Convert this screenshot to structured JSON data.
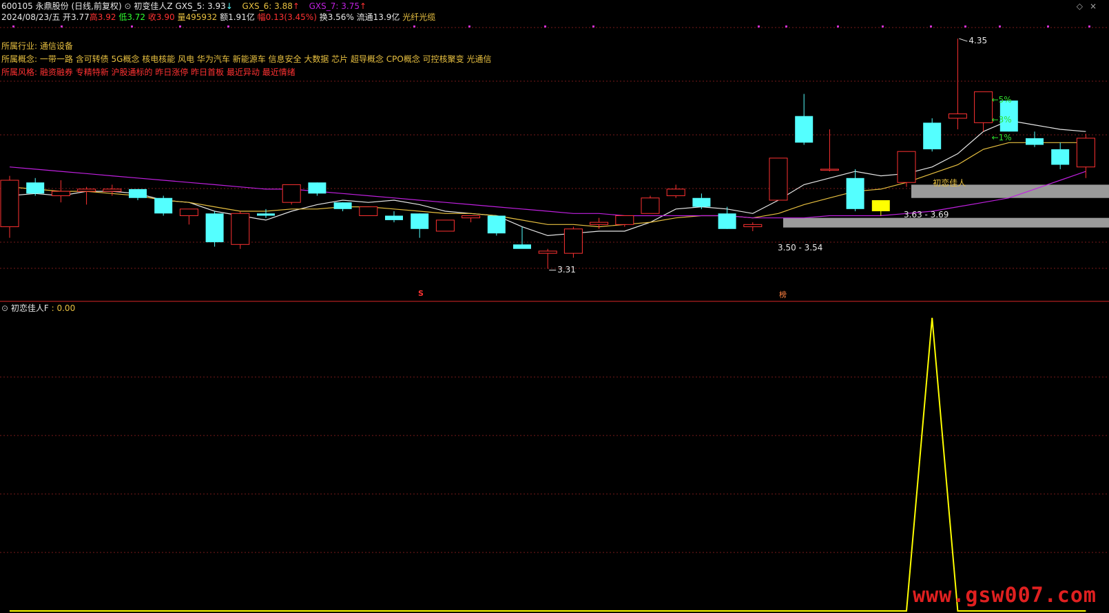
{
  "header": {
    "code": "600105",
    "name": "永鼎股份",
    "period": "(日线,前复权)",
    "indicator_name": "初变佳人Z",
    "gxs5": "GXS_5: 3.93",
    "gxs5_arrow": "↓",
    "gxs6": "GXS_6: 3.88",
    "gxs6_arrow": "↑",
    "gxs7": "GXS_7: 3.75",
    "gxs7_arrow": "↑",
    "collapse_glyph": "◇",
    "close_glyph": "×"
  },
  "quote": {
    "date": "2024/08/23/五",
    "open": "开3.77",
    "high": "高3.92",
    "low": "低3.72",
    "close": "收3.90",
    "volume": "量495932",
    "amount": "额1.91亿",
    "change": "幅0.13(3.45%)",
    "turnover": "换3.56%",
    "float": "流通13.9亿",
    "concept_tag": "光纤光缆"
  },
  "info": {
    "industry_label": "所属行业:",
    "industry_value": "通信设备",
    "concept_label": "所属概念:",
    "concept_value": "一带一路 含可转债 5G概念 核电核能 风电 华为汽车 新能源车 信息安全 大数据 芯片 超导概念 CPO概念 可控核聚变 光通信",
    "style_label": "所属风格:",
    "style_value": "融资融券 专精特新 沪股通标的 昨日涨停 昨日首板 最近异动 最近情绪"
  },
  "annotations": {
    "high_price": "4.35",
    "low_price": "3.31",
    "pct5": "←5%",
    "pct3": "←3%",
    "pct1": "←1%",
    "zone_upper": "3.63 - 3.69",
    "zone_lower": "3.50 - 3.54",
    "signal_label": "初恋佳人",
    "marker_s": "S",
    "marker_bang": "榜"
  },
  "sub_panel": {
    "title": "初恋佳人F",
    "value": ": 0.00"
  },
  "watermark": "www.gsw007.com",
  "colors": {
    "up": "#ff3232",
    "down": "#54ffff",
    "ma_white": "#e8e8e8",
    "ma_yellow": "#e8c040",
    "ma_purple": "#c020e0",
    "grid": "#7a1a1a",
    "signal": "#ffff00",
    "zone": "#9a9a9a"
  },
  "chart_data": {
    "type": "candlestick",
    "price_range": [
      3.25,
      4.4
    ],
    "dates_note": "",
    "candles": [
      {
        "o": 3.5,
        "h": 3.73,
        "l": 3.45,
        "c": 3.71
      },
      {
        "o": 3.7,
        "h": 3.72,
        "l": 3.64,
        "c": 3.65
      },
      {
        "o": 3.64,
        "h": 3.71,
        "l": 3.61,
        "c": 3.66
      },
      {
        "o": 3.66,
        "h": 3.68,
        "l": 3.6,
        "c": 3.67
      },
      {
        "o": 3.66,
        "h": 3.69,
        "l": 3.64,
        "c": 3.67
      },
      {
        "o": 3.67,
        "h": 3.67,
        "l": 3.62,
        "c": 3.63
      },
      {
        "o": 3.63,
        "h": 3.64,
        "l": 3.55,
        "c": 3.56
      },
      {
        "o": 3.55,
        "h": 3.58,
        "l": 3.51,
        "c": 3.58
      },
      {
        "o": 3.56,
        "h": 3.57,
        "l": 3.41,
        "c": 3.43
      },
      {
        "o": 3.42,
        "h": 3.57,
        "l": 3.4,
        "c": 3.56
      },
      {
        "o": 3.56,
        "h": 3.58,
        "l": 3.54,
        "c": 3.55
      },
      {
        "o": 3.61,
        "h": 3.69,
        "l": 3.6,
        "c": 3.69
      },
      {
        "o": 3.7,
        "h": 3.7,
        "l": 3.64,
        "c": 3.65
      },
      {
        "o": 3.61,
        "h": 3.61,
        "l": 3.57,
        "c": 3.58
      },
      {
        "o": 3.55,
        "h": 3.59,
        "l": 3.55,
        "c": 3.59
      },
      {
        "o": 3.55,
        "h": 3.57,
        "l": 3.52,
        "c": 3.53
      },
      {
        "o": 3.56,
        "h": 3.56,
        "l": 3.45,
        "c": 3.49
      },
      {
        "o": 3.48,
        "h": 3.53,
        "l": 3.48,
        "c": 3.53
      },
      {
        "o": 3.54,
        "h": 3.55,
        "l": 3.52,
        "c": 3.55
      },
      {
        "o": 3.55,
        "h": 3.55,
        "l": 3.46,
        "c": 3.47
      },
      {
        "o": 3.42,
        "h": 3.5,
        "l": 3.41,
        "c": 3.4
      },
      {
        "o": 3.38,
        "h": 3.4,
        "l": 3.31,
        "c": 3.39
      },
      {
        "o": 3.38,
        "h": 3.5,
        "l": 3.36,
        "c": 3.49
      },
      {
        "o": 3.51,
        "h": 3.54,
        "l": 3.49,
        "c": 3.52
      },
      {
        "o": 3.51,
        "h": 3.55,
        "l": 3.5,
        "c": 3.55
      },
      {
        "o": 3.56,
        "h": 3.64,
        "l": 3.56,
        "c": 3.63
      },
      {
        "o": 3.64,
        "h": 3.69,
        "l": 3.63,
        "c": 3.67
      },
      {
        "o": 3.63,
        "h": 3.65,
        "l": 3.58,
        "c": 3.59
      },
      {
        "o": 3.56,
        "h": 3.59,
        "l": 3.49,
        "c": 3.49
      },
      {
        "o": 3.5,
        "h": 3.52,
        "l": 3.48,
        "c": 3.51
      },
      {
        "o": 3.62,
        "h": 3.62,
        "l": 3.62,
        "c": 3.81
      },
      {
        "o": 4.0,
        "h": 4.1,
        "l": 3.87,
        "c": 3.88
      },
      {
        "o": 3.76,
        "h": 3.94,
        "l": 3.75,
        "c": 3.76
      },
      {
        "o": 3.72,
        "h": 3.76,
        "l": 3.57,
        "c": 3.58
      },
      {
        "o": 3.57,
        "h": 3.62,
        "l": 3.55,
        "c": 3.62
      },
      {
        "o": 3.7,
        "h": 3.84,
        "l": 3.68,
        "c": 3.84
      },
      {
        "o": 3.97,
        "h": 3.99,
        "l": 3.84,
        "c": 3.85
      },
      {
        "o": 3.99,
        "h": 4.35,
        "l": 3.94,
        "c": 4.01
      },
      {
        "o": 3.97,
        "h": 4.11,
        "l": 3.93,
        "c": 4.11
      },
      {
        "o": 4.07,
        "h": 4.07,
        "l": 3.93,
        "c": 3.93
      },
      {
        "o": 3.9,
        "h": 3.93,
        "l": 3.86,
        "c": 3.87
      },
      {
        "o": 3.85,
        "h": 3.88,
        "l": 3.76,
        "c": 3.78
      },
      {
        "o": 3.77,
        "h": 3.92,
        "l": 3.72,
        "c": 3.9
      }
    ],
    "series": [
      {
        "name": "GXS_5",
        "color": "white",
        "values": [
          3.64,
          3.65,
          3.64,
          3.66,
          3.66,
          3.65,
          3.62,
          3.61,
          3.57,
          3.55,
          3.53,
          3.57,
          3.6,
          3.62,
          3.61,
          3.62,
          3.6,
          3.57,
          3.56,
          3.55,
          3.5,
          3.46,
          3.47,
          3.48,
          3.48,
          3.52,
          3.58,
          3.59,
          3.58,
          3.56,
          3.62,
          3.69,
          3.72,
          3.75,
          3.73,
          3.74,
          3.77,
          3.83,
          3.93,
          3.98,
          3.96,
          3.94,
          3.93
        ]
      },
      {
        "name": "GXS_6",
        "color": "yellow",
        "values": [
          3.68,
          3.67,
          3.66,
          3.66,
          3.65,
          3.64,
          3.62,
          3.61,
          3.59,
          3.57,
          3.57,
          3.58,
          3.58,
          3.59,
          3.59,
          3.58,
          3.57,
          3.56,
          3.56,
          3.55,
          3.53,
          3.51,
          3.51,
          3.5,
          3.51,
          3.52,
          3.54,
          3.55,
          3.55,
          3.54,
          3.56,
          3.6,
          3.63,
          3.66,
          3.67,
          3.7,
          3.74,
          3.78,
          3.85,
          3.88,
          3.88,
          3.88,
          3.88
        ]
      },
      {
        "name": "GXS_7",
        "color": "purple",
        "values": [
          3.77,
          3.76,
          3.75,
          3.74,
          3.73,
          3.72,
          3.71,
          3.7,
          3.69,
          3.68,
          3.67,
          3.67,
          3.66,
          3.65,
          3.64,
          3.63,
          3.62,
          3.61,
          3.6,
          3.59,
          3.58,
          3.57,
          3.56,
          3.56,
          3.55,
          3.55,
          3.55,
          3.55,
          3.55,
          3.54,
          3.54,
          3.54,
          3.55,
          3.55,
          3.55,
          3.56,
          3.57,
          3.59,
          3.61,
          3.63,
          3.67,
          3.71,
          3.75
        ]
      }
    ],
    "zones": [
      {
        "low": 3.63,
        "high": 3.69,
        "label": "3.63 - 3.69",
        "start_index": 35
      },
      {
        "low": 3.5,
        "high": 3.54,
        "label": "3.50 - 3.54",
        "start_index": 30
      }
    ],
    "sub_series": {
      "name": "初恋佳人F",
      "values": [
        0,
        0,
        0,
        0,
        0,
        0,
        0,
        0,
        0,
        0,
        0,
        0,
        0,
        0,
        0,
        0,
        0,
        0,
        0,
        0,
        0,
        0,
        0,
        0,
        0,
        0,
        0,
        0,
        0,
        0,
        0,
        0,
        0,
        0,
        0,
        0,
        1,
        0,
        0,
        0,
        0,
        0,
        0
      ]
    }
  }
}
